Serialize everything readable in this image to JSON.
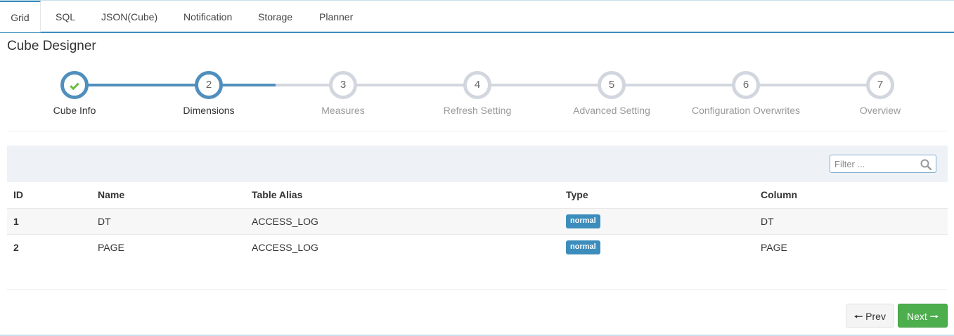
{
  "tabs": [
    "Grid",
    "SQL",
    "JSON(Cube)",
    "Notification",
    "Storage",
    "Planner"
  ],
  "active_tab": "Grid",
  "page_title": "Cube Designer",
  "wizard": {
    "steps": [
      {
        "number": "",
        "label": "Cube Info",
        "state": "done"
      },
      {
        "number": "2",
        "label": "Dimensions",
        "state": "current"
      },
      {
        "number": "3",
        "label": "Measures",
        "state": "pending"
      },
      {
        "number": "4",
        "label": "Refresh Setting",
        "state": "pending"
      },
      {
        "number": "5",
        "label": "Advanced Setting",
        "state": "pending"
      },
      {
        "number": "6",
        "label": "Configuration Overwrites",
        "state": "pending"
      },
      {
        "number": "7",
        "label": "Overview",
        "state": "pending"
      }
    ]
  },
  "filter": {
    "placeholder": "Filter ...",
    "icon": "search-icon"
  },
  "table": {
    "columns": [
      "ID",
      "Name",
      "Table Alias",
      "Type",
      "Column"
    ],
    "rows": [
      {
        "id": "1",
        "name": "DT",
        "table_alias": "ACCESS_LOG",
        "type": "normal",
        "column": "DT"
      },
      {
        "id": "2",
        "name": "PAGE",
        "table_alias": "ACCESS_LOG",
        "type": "normal",
        "column": "PAGE"
      }
    ]
  },
  "buttons": {
    "prev": "Prev",
    "next": "Next"
  },
  "colors": {
    "accent": "#3c8dbc",
    "success": "#4cae4c",
    "check": "#6abe3d",
    "pending": "#d2d6de"
  }
}
